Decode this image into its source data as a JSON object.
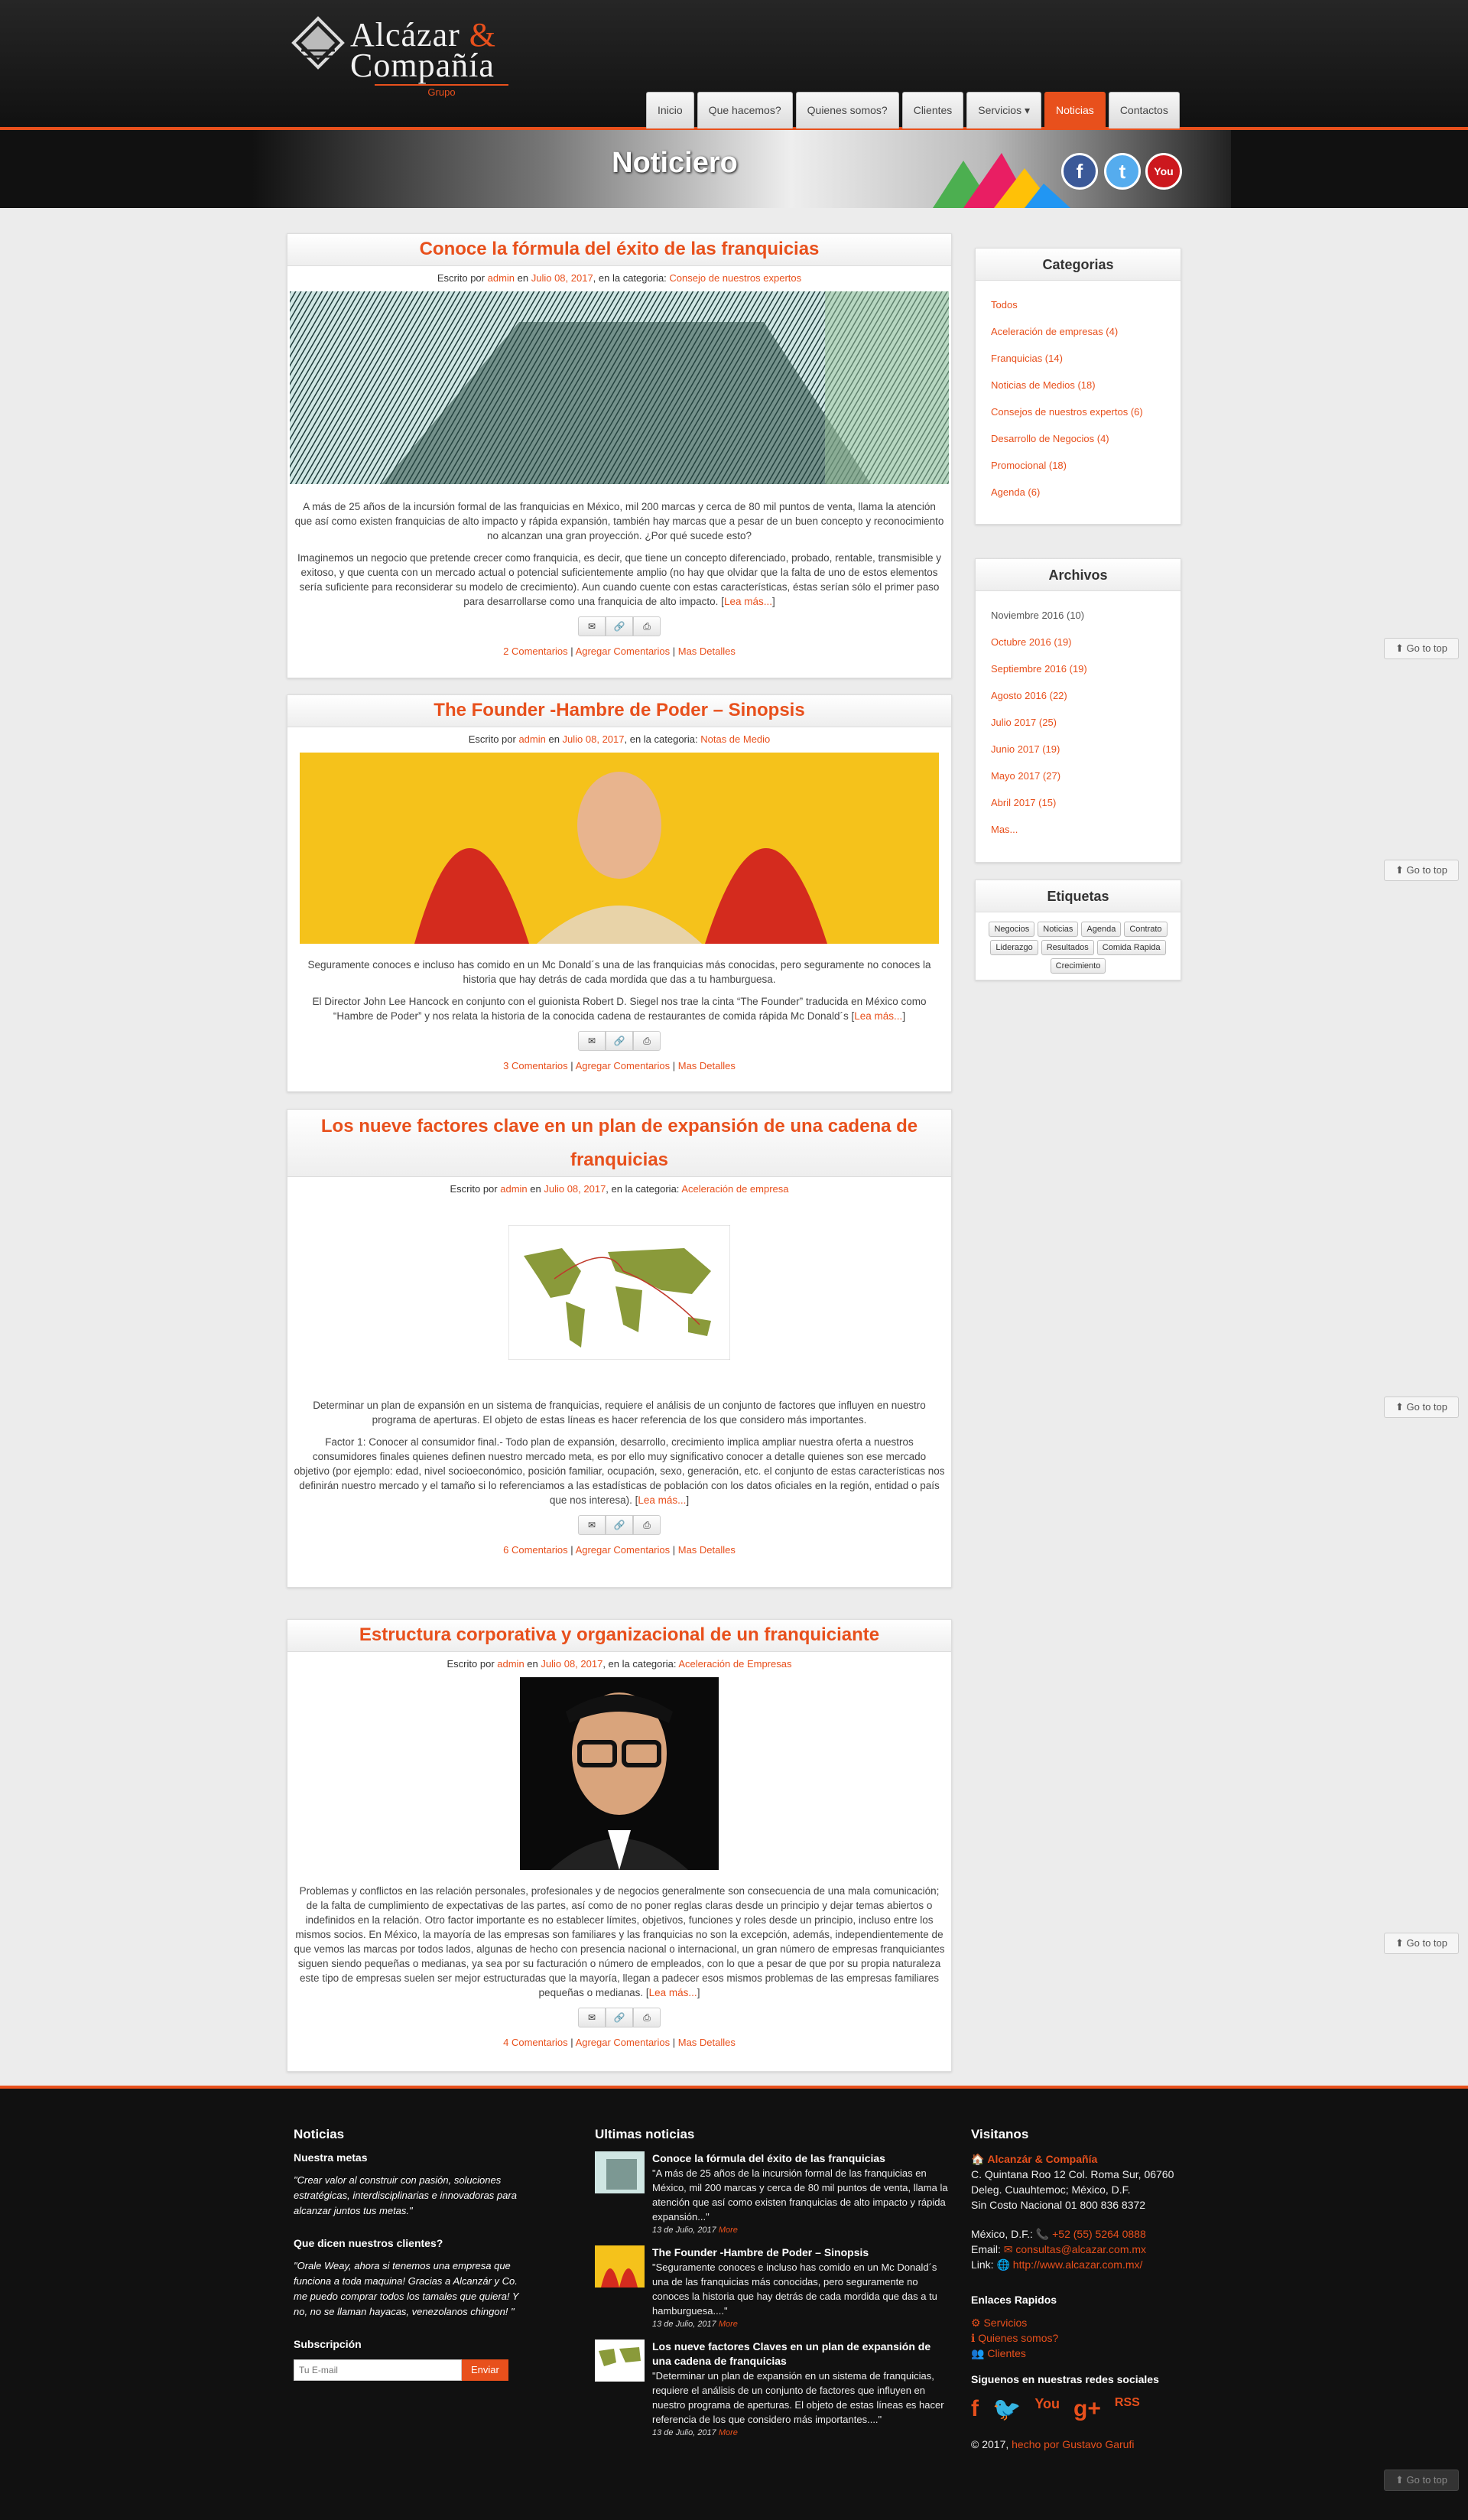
{
  "header": {
    "logo_line1": "Alcázar",
    "logo_amp": "&",
    "logo_line2": "Compañía",
    "logo_sub": "Grupo",
    "nav": [
      "Inicio",
      "Que hacemos?",
      "Quienes somos?",
      "Clientes",
      "Servicios ▾",
      "Noticias",
      "Contactos"
    ],
    "banner_title": "Noticiero",
    "social": [
      "f",
      "t",
      "You"
    ]
  },
  "posts": [
    {
      "title": "Conoce la fórmula del éxito de las franquicias",
      "by": "Escrito por ",
      "author": "admin",
      "on": " en ",
      "date": "Julio 08, 2017",
      "cat_pre": ", en la categoria: ",
      "category": "Consejo de nuestros expertos",
      "p1": "A más de 25 años de la incursión formal de las franquicias en México, mil 200 marcas y cerca de 80 mil puntos de venta, llama la atención que así como existen franquicias de alto impacto y rápida expansión, también hay marcas que a pesar de un buen concepto y reconocimiento no alcanzan una gran proyección. ¿Por qué sucede esto?",
      "p2": "Imaginemos un negocio que pretende crecer como franquicia, es decir, que tiene un concepto diferenciado, probado, rentable, transmisible y exitoso, y que cuenta con un mercado actual o potencial suficientemente amplio (no hay que olvidar que la falta de uno de estos elementos sería suficiente para reconsiderar su modelo de crecimiento). Aun cuando cuente con estas características, éstas serían sólo el primer paso para desarrollarse como una franquicia de alto impacto. [",
      "more": "Lea más...",
      "close": "]",
      "comments": "2 Comentarios",
      "add": "Agregar Comentarios",
      "details": "Mas Detalles"
    },
    {
      "title": "The Founder -Hambre de Poder – Sinopsis",
      "by": "Escrito por ",
      "author": "admin",
      "on": " en ",
      "date": "Julio 08, 2017",
      "cat_pre": ", en la categoria: ",
      "category": "Notas de Medio",
      "p1": "Seguramente conoces e incluso has comido en un Mc Donald´s una de las franquicias más conocidas, pero seguramente no conoces la historia que hay detrás de cada mordida que das a tu hamburguesa.",
      "p2": "El Director John Lee Hancock en conjunto con el guionista Robert D. Siegel nos trae la cinta “The Founder” traducida en México como “Hambre de Poder” y nos relata la historia de la conocida cadena de restaurantes de comida rápida Mc Donald´s [",
      "more": "Lea más...",
      "close": "]",
      "comments": "3 Comentarios",
      "add": "Agregar Comentarios",
      "details": "Mas Detalles"
    },
    {
      "title": "Los nueve factores clave en un plan de expansión de una cadena de franquicias",
      "by": "Escrito por ",
      "author": "admin",
      "on": " en ",
      "date": "Julio 08, 2017",
      "cat_pre": ", en la categoria: ",
      "category": "Aceleración de empresa",
      "p1": "Determinar un plan de expansión en un sistema de franquicias, requiere el análisis de un conjunto de factores que influyen en nuestro programa de aperturas. El objeto de estas líneas es hacer referencia de los que considero más importantes.",
      "p2": "Factor 1: Conocer al consumidor final.- Todo plan de expansión, desarrollo, crecimiento implica ampliar nuestra oferta a nuestros consumidores finales quienes definen nuestro mercado meta, es por ello muy significativo conocer a detalle quienes son ese mercado objetivo (por ejemplo: edad, nivel socioeconómico, posición familiar, ocupación, sexo, generación, etc. el conjunto de estas características nos definirán nuestro mercado y el tamaño si lo referenciamos a las estadísticas de población con los datos oficiales en la región, entidad o país que nos interesa). [",
      "more": "Lea más...",
      "close": "]",
      "comments": "6 Comentarios",
      "add": "Agregar Comentarios",
      "details": "Mas Detalles"
    },
    {
      "title": "Estructura corporativa y organizacional de un franquiciante",
      "by": "Escrito por ",
      "author": "admin",
      "on": " en ",
      "date": "Julio 08, 2017",
      "cat_pre": ", en la categoria: ",
      "category": "Aceleración de Empresas",
      "p1": "Problemas y conflictos en las relación personales, profesionales y de negocios generalmente son consecuencia de una mala comunicación; de la falta de cumplimiento de expectativas de las partes, así como de no poner reglas claras desde un principio y dejar temas abiertos o indefinidos en la relación. Otro factor importante es no establecer límites, objetivos, funciones y roles desde un principio, incluso entre los mismos socios. En México, la mayoría de las empresas son familiares y las franquicias no son la excepción, además, independientemente de que vemos las marcas por todos lados, algunas de hecho con presencia nacional o internacional, un gran número de empresas franquiciantes siguen siendo pequeñas o medianas, ya sea por su facturación o número de empleados, con lo que a pesar de que por su propia naturaleza este tipo de empresas suelen ser mejor estructuradas que la mayoría, llegan a padecer esos mismos problemas de las empresas familiares pequeñas o medianas. [",
      "p2": "",
      "more": "Lea más...",
      "close": "]",
      "comments": "4 Comentarios",
      "add": "Agregar Comentarios",
      "details": "Mas Detalles"
    }
  ],
  "sidebar": {
    "cat_title": "Categorias",
    "cats": [
      "Todos",
      "Aceleración de empresas (4)",
      "Franquicias (14)",
      "Noticias de Medios (18)",
      "Consejos de nuestros expertos (6)",
      "Desarrollo de Negocios (4)",
      "Promocional (18)",
      "Agenda (6)"
    ],
    "arch_title": "Archivos",
    "archives": [
      "Noviembre 2016 (10)",
      "Octubre 2016 (19)",
      "Septiembre 2016 (19)",
      "Agosto 2016 (22)",
      "Julio 2017 (25)",
      "Junio 2017 (19)",
      "Mayo 2017 (27)",
      "Abril 2017 (15)",
      "Mas..."
    ],
    "tag_title": "Etiquetas",
    "tags": [
      "Negocios",
      "Noticias",
      "Agenda",
      "Contrato",
      "Liderazgo",
      "Resultados",
      "Comida Rapida",
      "Crecimiento"
    ]
  },
  "gotop": "Go to top",
  "footer": {
    "noticias": "Noticias",
    "metas_title": "Nuestra metas",
    "metas": "\"Crear valor al construir con pasión, soluciones estratégicas, interdisciplinarias e innovadoras para alcanzar juntos tus metas.\"",
    "clientes_title": "Que dicen nuestros clientes?",
    "clientes": "\"Orale Weay, ahora si tenemos una empresa que funciona a toda maquina! Gracias a Alcanzár y Co. me puedo comprar todos los tamales que quiera! Y no, no se llaman hayacas, venezolanos chingon! \"",
    "sub_title": "Subscripción",
    "email_ph": "Tu E-mail",
    "send": "Enviar",
    "ultimas": "Ultimas noticias",
    "news": [
      {
        "t": "Conoce la fórmula del éxito de las franquicias",
        "x": "\"A más de 25 años de la incursión formal de las franquicias en México, mil 200 marcas y cerca de 80 mil puntos de venta, llama la atención que así como existen franquicias de alto impacto y rápida expansión...\"",
        "d": "13 de Julio, 2017",
        "m": "More"
      },
      {
        "t": "The Founder -Hambre de Poder – Sinopsis",
        "x": "\"Seguramente conoces e incluso has comido en un Mc Donald´s una de las franquicias más conocidas, pero seguramente no conoces la historia que hay detrás de cada mordida que das a tu hamburguesa....\"",
        "d": "13 de Julio, 2017",
        "m": "More"
      },
      {
        "t": "Los nueve factores Claves en un plan de expansión de una cadena de franquicias",
        "x": "\"Determinar un plan de expansión en un sistema de franquicias, requiere el análisis de un conjunto de factores que influyen en nuestro programa de aperturas. El objeto de estas líneas es hacer referencia de los que considero más importantes....\"",
        "d": "13 de Julio, 2017",
        "m": "More"
      }
    ],
    "visit": "Visitanos",
    "company": "Alcanzár & Compañía",
    "addr1": "C. Quintana Roo 12 Col. Roma Sur, 06760",
    "addr2": "Deleg. Cuauhtemoc; México, D.F.",
    "addr3": "Sin Costo Nacional 01 800 836 8372",
    "city": "México, D.F.:",
    "phone": "+52 (55) 5264 0888",
    "email_l": "Email:",
    "email": "consultas@alcazar.com.mx",
    "link_l": "Link:",
    "link": "http://www.alcazar.com.mx/",
    "quick": "Enlaces Rapidos",
    "q": [
      "Servicios",
      "Quienes somos?",
      "Clientes"
    ],
    "follow": "Siguenos en nuestras redes sociales",
    "fsoc": [
      "f",
      "🐦",
      "You",
      "g+",
      "RSS"
    ],
    "copy": "© 2017,",
    "made": "hecho por Gustavo Garufi"
  },
  "colors": {
    "accent": "#e8501c",
    "header": "#1b1b1b"
  }
}
